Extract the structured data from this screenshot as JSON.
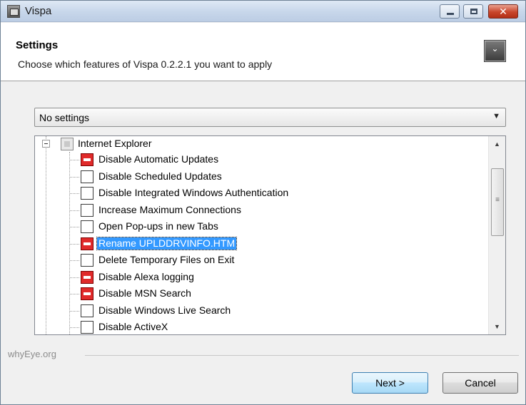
{
  "window": {
    "title": "Vispa",
    "close_glyph": "✕"
  },
  "header": {
    "title": "Settings",
    "subtitle": "Choose which features of Vispa 0.2.2.1 you want to apply",
    "icon_glyph": "⌄"
  },
  "dropdown": {
    "value": "No settings",
    "arrow": "▼"
  },
  "tree": {
    "root": {
      "label": "Internet Explorer",
      "state": "partial"
    },
    "items": [
      {
        "label": "Disable Automatic Updates",
        "checked": true,
        "selected": false
      },
      {
        "label": "Disable Scheduled Updates",
        "checked": false,
        "selected": false
      },
      {
        "label": "Disable Integrated Windows Authentication",
        "checked": false,
        "selected": false
      },
      {
        "label": "Increase Maximum Connections",
        "checked": false,
        "selected": false
      },
      {
        "label": "Open Pop-ups in new Tabs",
        "checked": false,
        "selected": false
      },
      {
        "label": "Rename UPLDDRVINFO.HTM",
        "checked": true,
        "selected": true
      },
      {
        "label": "Delete Temporary Files on Exit",
        "checked": false,
        "selected": false
      },
      {
        "label": "Disable Alexa logging",
        "checked": true,
        "selected": false
      },
      {
        "label": "Disable MSN Search",
        "checked": true,
        "selected": false
      },
      {
        "label": "Disable Windows Live Search",
        "checked": false,
        "selected": false
      },
      {
        "label": "Disable ActiveX",
        "checked": false,
        "selected": false
      }
    ]
  },
  "scrollbar": {
    "up": "▲",
    "down": "▼",
    "grip": "≡"
  },
  "footer": {
    "brand": "whyEye.org",
    "next_label": "Next >",
    "cancel_label": "Cancel"
  }
}
